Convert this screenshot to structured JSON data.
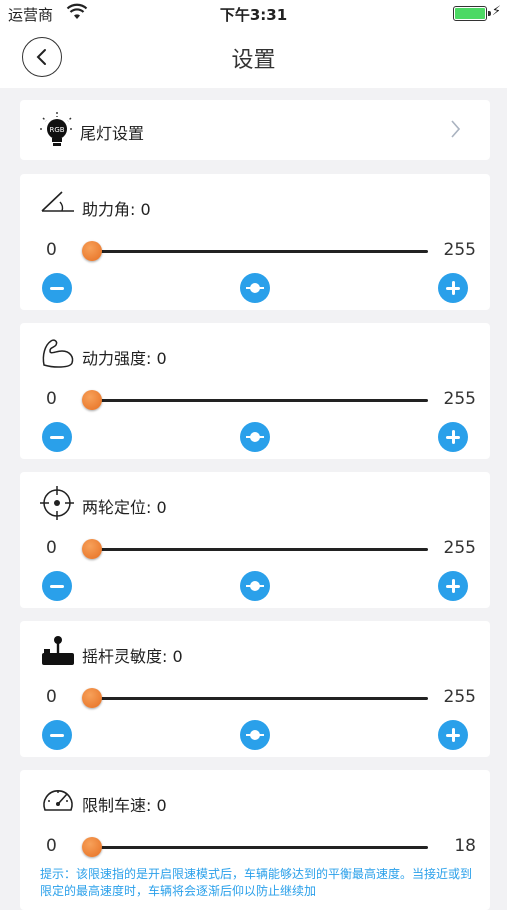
{
  "status_bar": {
    "carrier": "运营商",
    "time": "下午3:31",
    "battery_level": 1.0,
    "charging": true
  },
  "nav": {
    "title": "设置"
  },
  "taillight": {
    "label": "尾灯设置",
    "icon_text": "RGB"
  },
  "sliders": [
    {
      "label": "助力角: 0",
      "min": "0",
      "max": "255",
      "value": 0,
      "range": [
        0,
        255
      ],
      "icon": "angle-icon"
    },
    {
      "label": "动力强度: 0",
      "min": "0",
      "max": "255",
      "value": 0,
      "range": [
        0,
        255
      ],
      "icon": "muscle-arm-icon"
    },
    {
      "label": "两轮定位: 0",
      "min": "0",
      "max": "255",
      "value": 0,
      "range": [
        0,
        255
      ],
      "icon": "crosshair-icon"
    },
    {
      "label": "摇杆灵敏度: 0",
      "min": "0",
      "max": "255",
      "value": 0,
      "range": [
        0,
        255
      ],
      "icon": "joystick-icon"
    }
  ],
  "speed": {
    "label": "限制车速: 0",
    "min": "0",
    "max": "18",
    "value": 0,
    "range": [
      0,
      18
    ],
    "icon": "speedometer-icon",
    "hint": "提示：该限速指的是开启限速模式后，车辆能够达到的平衡最高速度。当接近或到限定的最高速度时，车辆将会逐渐后仰以防止继续加"
  },
  "colors": {
    "accent": "#2aa0ea",
    "thumb": "#e66f22",
    "battery": "#4cd964"
  }
}
